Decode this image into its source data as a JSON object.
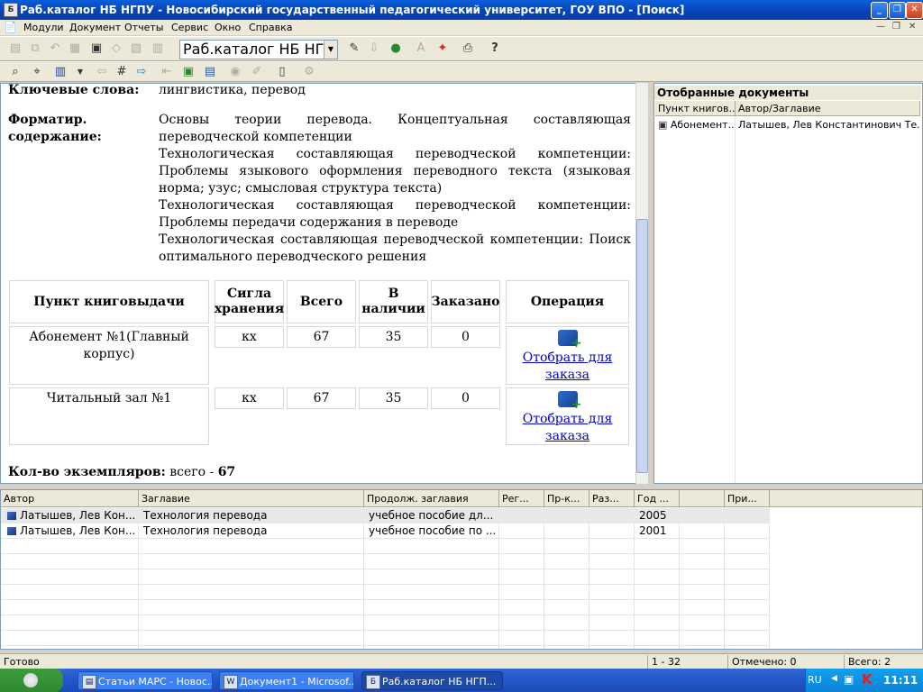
{
  "window": {
    "title": "Раб.каталог НБ НГПУ - Новосибирский государственный педагогический университет, ГОУ ВПО - [Поиск]"
  },
  "menu": {
    "items": [
      "Модули",
      "Документ",
      "Отчеты",
      "Сервис",
      "Окно",
      "Справка"
    ]
  },
  "toolbar": {
    "catalog_combo": "Раб.каталог НБ НГПУ"
  },
  "document": {
    "keywords_label": "Ключевые слова:",
    "keywords_value": "лингвистика, перевод",
    "formatted_label_1": "Форматир.",
    "formatted_label_2": "содержание:",
    "contents": [
      "Основы теории перевода. Концептуальная составляющая переводческой компетенции",
      "Технологическая составляющая переводческой компетенции: Проблемы языкового оформления переводного текста (языковая норма; узус; смысловая структура текста)",
      "Технологическая составляющая переводческой компетенции: Проблемы передачи содержания в переводе",
      "Технологическая составляющая переводческой компетенции: Поиск оптимального переводческого решения"
    ],
    "holdings": {
      "headers": {
        "point": "Пункт книговыдачи",
        "sigla": "Сигла хранения",
        "total": "Всего",
        "available": "В наличии",
        "ordered": "Заказано",
        "operation": "Операция"
      },
      "rows": [
        {
          "point": "Абонемент №1(Главный корпус)",
          "sigla": "кх",
          "total": "67",
          "available": "35",
          "ordered": "0",
          "action": "Отобрать для заказа"
        },
        {
          "point": "Читальный зал №1",
          "sigla": "кх",
          "total": "67",
          "available": "35",
          "ordered": "0",
          "action": "Отобрать для заказа"
        }
      ]
    },
    "copies_label": "Кол-во экземпляров:",
    "copies_value": "всего -",
    "copies_total": "67"
  },
  "selected_docs": {
    "title": "Отобранные документы",
    "col_point": "Пункт книгов...",
    "col_author": "Автор/Заглавие",
    "row_point": "Абонемент...",
    "row_author": "Латышев, Лев Константинович Те..."
  },
  "results": {
    "columns": [
      "Автор",
      "Заглавие",
      "Продолж. заглавия",
      "Рег...",
      "Пр-к...",
      "Раз...",
      "Год ...",
      "",
      "При..."
    ],
    "rows": [
      {
        "author": "Латышев, Лев Кон...",
        "title": "Технология перевода",
        "subtitle": "учебное пособие дл...",
        "year": "2005"
      },
      {
        "author": "Латышев, Лев Кон...",
        "title": "Технология перевода",
        "subtitle": "учебное пособие по ...",
        "year": "2001"
      }
    ]
  },
  "status": {
    "ready": "Готово",
    "range": "1 - 32",
    "marked": "Отмечено: 0",
    "total": "Всего: 2"
  },
  "taskbar": {
    "tasks": [
      "Статьи МАРС - Новос...",
      "Документ1 - Microsof...",
      "Раб.каталог НБ НГП..."
    ],
    "lang": "RU",
    "clock": "11:11"
  }
}
